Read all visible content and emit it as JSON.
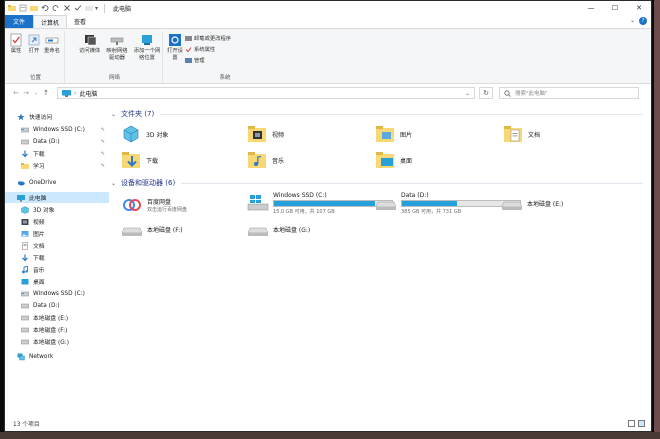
{
  "title_bar": {
    "title": "此电脑"
  },
  "ribbon_tabs": [
    {
      "label": "文件"
    },
    {
      "label": "计算机"
    },
    {
      "label": "查看"
    }
  ],
  "ribbon": {
    "location": {
      "label": "位置",
      "buttons": [
        "属性",
        "打开",
        "重命名"
      ]
    },
    "network": {
      "label": "网络",
      "buttons": [
        "访问媒体",
        "映射网络驱动器",
        "添加一个网络位置"
      ]
    },
    "system": {
      "label": "系统",
      "open_settings": "打开设置",
      "small": [
        "卸载或更改程序",
        "系统属性",
        "管理"
      ]
    }
  },
  "address": {
    "path": "此电脑",
    "search_placeholder": "搜索\"此电脑\""
  },
  "sidebar": {
    "items": [
      {
        "label": "快速访问",
        "icon": "star-icon"
      },
      {
        "label": "Windows SSD (C:)",
        "icon": "drive-icon",
        "pinned": true
      },
      {
        "label": "Data (D:)",
        "icon": "drive-icon",
        "pinned": true
      },
      {
        "label": "下载",
        "icon": "download-icon",
        "pinned": true
      },
      {
        "label": "学习",
        "icon": "folder-icon",
        "pinned": true
      },
      {
        "label": "OneDrive",
        "icon": "cloud-icon"
      },
      {
        "label": "此电脑",
        "icon": "computer-icon",
        "selected": true
      },
      {
        "label": "3D 对象",
        "icon": "cube-icon"
      },
      {
        "label": "视频",
        "icon": "video-icon"
      },
      {
        "label": "图片",
        "icon": "picture-icon"
      },
      {
        "label": "文档",
        "icon": "document-icon"
      },
      {
        "label": "下载",
        "icon": "download-icon"
      },
      {
        "label": "音乐",
        "icon": "music-icon"
      },
      {
        "label": "桌面",
        "icon": "desktop-icon"
      },
      {
        "label": "Windows SSD (C:)",
        "icon": "drive-icon"
      },
      {
        "label": "Data (D:)",
        "icon": "drive-icon"
      },
      {
        "label": "本地磁盘 (E:)",
        "icon": "drive-icon"
      },
      {
        "label": "本地磁盘 (F:)",
        "icon": "drive-icon"
      },
      {
        "label": "本地磁盘 (G:)",
        "icon": "drive-icon"
      },
      {
        "label": "Network",
        "icon": "network-icon"
      }
    ]
  },
  "folders": {
    "header": "文件夹 (7)",
    "items": [
      {
        "label": "3D 对象"
      },
      {
        "label": "视频"
      },
      {
        "label": "图片"
      },
      {
        "label": "文档"
      },
      {
        "label": "下载"
      },
      {
        "label": "音乐"
      },
      {
        "label": "桌面"
      }
    ]
  },
  "drives": {
    "header": "设备和驱动器 (6)",
    "items": [
      {
        "name": "百度网盘",
        "sub": "双击运行百度网盘",
        "type": "app"
      },
      {
        "name": "Windows SSD (C:)",
        "sub": "15.0 GB 可用，共 107 GB",
        "used_fraction": 0.86,
        "type": "windows"
      },
      {
        "name": "Data (D:)",
        "sub": "385 GB 可用，共 731 GB",
        "used_fraction": 0.47,
        "type": "disk"
      },
      {
        "name": "本地磁盘 (E:)",
        "type": "disk"
      },
      {
        "name": "本地磁盘 (F:)",
        "type": "disk"
      },
      {
        "name": "本地磁盘 (G:)",
        "type": "disk"
      }
    ]
  },
  "status": {
    "count": "13 个项目"
  },
  "colors": {
    "accent": "#1a73c8",
    "selected_bg": "#cce8ff",
    "bar_fill": "#26a0da",
    "folder": "#f8d775"
  }
}
